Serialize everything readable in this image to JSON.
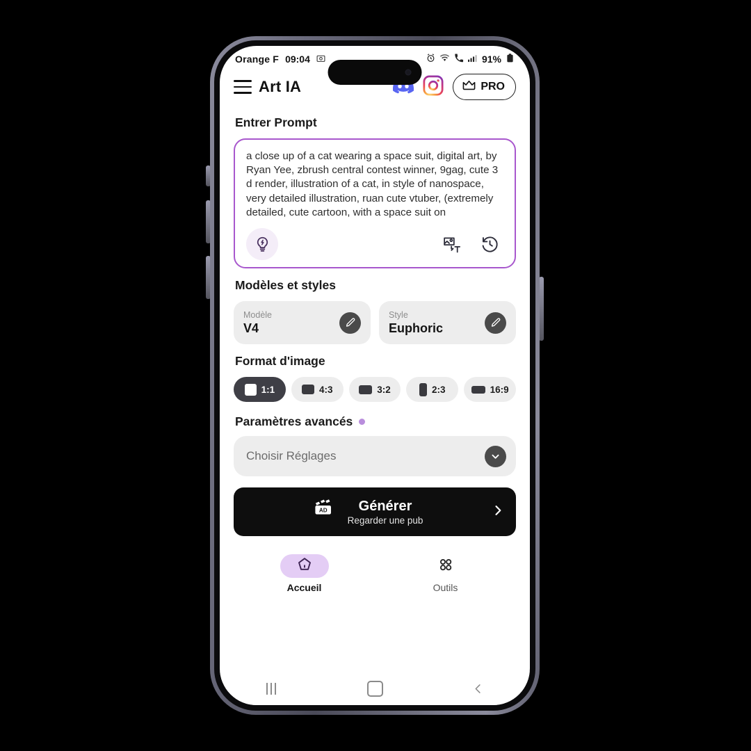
{
  "status_bar": {
    "carrier": "Orange F",
    "time": "09:04",
    "battery_percent": "91%",
    "icons": [
      "screenshot-icon",
      "alarm-icon",
      "wifi-icon",
      "wifi-calling-icon",
      "signal-icon",
      "battery-icon"
    ]
  },
  "header": {
    "menu_icon": "hamburger-menu-icon",
    "title": "Art IA",
    "discord_icon": "discord-icon",
    "instagram_icon": "instagram-icon",
    "pro_label": "PRO",
    "pro_icon": "crown-icon"
  },
  "prompt_section": {
    "title": "Entrer Prompt",
    "text": "a close up of a cat wearing a space suit, digital art, by Ryan Yee, zbrush central contest winner, 9gag, cute 3 d render, illustration of a cat, in style of nanospace, very detailed illustration, ruan cute vtuber, (extremely detailed, cute cartoon, with a space suit on",
    "idea_icon": "lightbulb-idea-icon",
    "image_to_text_icon": "image-to-text-icon",
    "history_icon": "history-icon",
    "border_color": "#a857cd"
  },
  "models_section": {
    "title": "Modèles et styles",
    "model": {
      "label": "Modèle",
      "value": "V4",
      "edit_icon": "pencil-edit-icon"
    },
    "style": {
      "label": "Style",
      "value": "Euphoric",
      "edit_icon": "pencil-edit-icon"
    }
  },
  "format_section": {
    "title": "Format d'image",
    "options": [
      {
        "label": "1:1",
        "selected": true
      },
      {
        "label": "4:3",
        "selected": false
      },
      {
        "label": "3:2",
        "selected": false
      },
      {
        "label": "2:3",
        "selected": false
      },
      {
        "label": "16:9",
        "selected": false
      }
    ]
  },
  "advanced_section": {
    "title": "Paramètres avancés",
    "badge_color": "#b98ddc",
    "dropdown_label": "Choisir Réglages",
    "dropdown_icon": "chevron-down-icon"
  },
  "generate_button": {
    "title": "Générer",
    "subtitle": "Regarder une pub",
    "ad_icon": "ad-clapperboard-icon",
    "ad_badge_text": "AD",
    "chevron_icon": "chevron-right-icon"
  },
  "bottom_nav": {
    "items": [
      {
        "label": "Accueil",
        "icon": "home-pentagon-icon",
        "active": true
      },
      {
        "label": "Outils",
        "icon": "grid-dots-icon",
        "active": false
      }
    ]
  },
  "android_nav": {
    "recents_icon": "recents-icon",
    "home_icon": "home-square-icon",
    "back_icon": "back-chevron-icon"
  }
}
